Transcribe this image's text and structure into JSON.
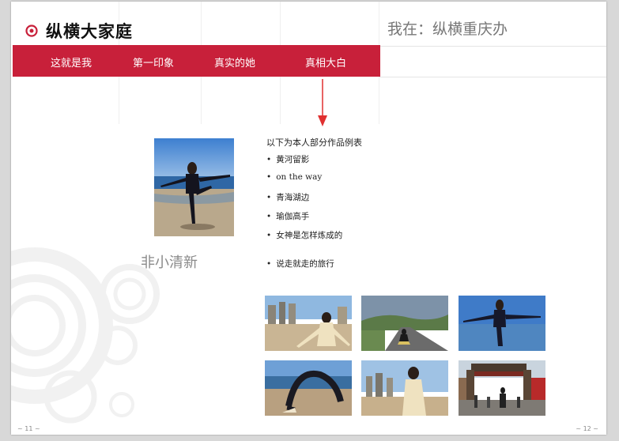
{
  "header": {
    "brand_title": "纵横大家庭",
    "location": "我在：纵横重庆办"
  },
  "nav": {
    "items": [
      {
        "label": "这就是我"
      },
      {
        "label": "第一印象"
      },
      {
        "label": "真实的她"
      },
      {
        "label": "真相大白"
      }
    ],
    "accent_color": "#c8203a"
  },
  "main": {
    "caption": "非小清新",
    "list_title": "以下为本人部分作品例表",
    "works": [
      {
        "label": "黄河留影"
      },
      {
        "label": "on the way"
      },
      {
        "label": "青海湖边"
      },
      {
        "label": "瑜伽高手"
      },
      {
        "label": "女神是怎样炼成的"
      },
      {
        "label": "说走就走的旅行"
      }
    ],
    "bullet": "•"
  },
  "footer": {
    "page_left": "~ 11 ~",
    "page_right": "~ 12 ~"
  }
}
